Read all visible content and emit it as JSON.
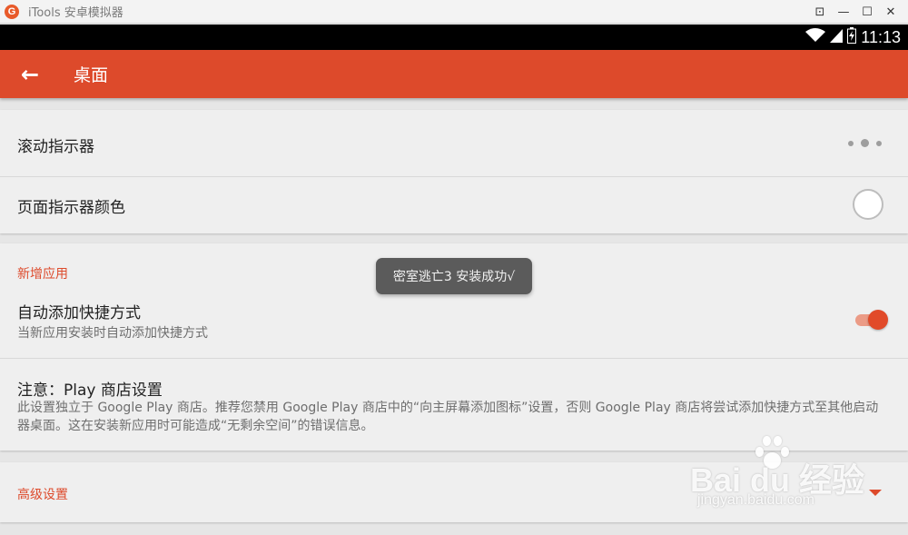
{
  "window": {
    "title": "iTools 安卓模拟器",
    "logo_letter": "G",
    "controls": [
      "⊡",
      "—",
      "☐",
      "✕"
    ]
  },
  "status_bar": {
    "time": "11:13",
    "icons": [
      "wifi-icon",
      "signal-icon",
      "battery-charging-icon"
    ]
  },
  "app_bar": {
    "back_icon": "←",
    "title": "桌面"
  },
  "settings": {
    "scroll_indicator": {
      "label": "滚动指示器"
    },
    "page_indicator_color": {
      "label": "页面指示器颜色",
      "color": "#ffffff"
    },
    "new_apps_section": {
      "title": "新增应用"
    },
    "auto_add_shortcut": {
      "label": "自动添加快捷方式",
      "summary": "当新应用安装时自动添加快捷方式",
      "enabled": true
    },
    "notice": {
      "title": "注意：Play 商店设置",
      "text": "此设置独立于 Google Play 商店。推荐您禁用 Google Play 商店中的“向主屏幕添加图标”设置，否则 Google Play 商店将尝试添加快捷方式至其他启动器桌面。这在安装新应用时可能造成“无剩余空间”的错误信息。"
    },
    "advanced": {
      "title": "高级设置"
    }
  },
  "toast": {
    "text": "密室逃亡3 安装成功√"
  },
  "watermark": {
    "brand": "Bai du 经验",
    "url": "jingyan.baidu.com"
  },
  "colors": {
    "accent": "#dd4a2b",
    "status_bar": "#000000",
    "title_bar": "#f3f3f3"
  }
}
